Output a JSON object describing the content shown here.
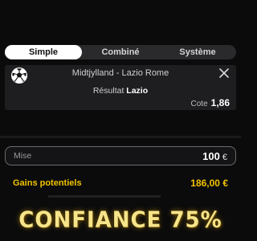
{
  "tabs": [
    {
      "label": "Simple",
      "active": true
    },
    {
      "label": "Combiné",
      "active": false
    },
    {
      "label": "Système",
      "active": false
    }
  ],
  "bet": {
    "sport_icon": "football-icon",
    "match": "Midtjylland - Lazio Rome",
    "result_label": "Résultat",
    "result_value": "Lazio",
    "odds_label": "Cote",
    "odds_value": "1,86"
  },
  "stake": {
    "label": "Mise",
    "value": "100",
    "currency": "€"
  },
  "gains": {
    "label": "Gains potentiels",
    "value": "186,00 €"
  },
  "overlay_text": "CONFIANCE 75%",
  "colors": {
    "accent_yellow": "#f0c300",
    "tab_active_bg": "#ffffff",
    "card_bg": "#1e1e21"
  }
}
